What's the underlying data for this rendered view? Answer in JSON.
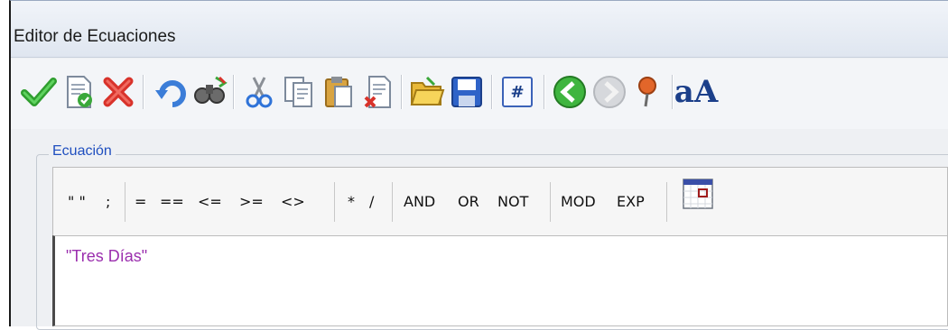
{
  "window": {
    "title": "Editor de Ecuaciones"
  },
  "toolbar": {
    "buttons": [
      {
        "name": "accept",
        "icon": "checkmark-icon"
      },
      {
        "name": "validate",
        "icon": "document-check-icon"
      },
      {
        "name": "cancel",
        "icon": "close-x-icon"
      },
      {
        "name": "undo",
        "icon": "undo-icon"
      },
      {
        "name": "find-replace",
        "icon": "binoculars-icon"
      },
      {
        "name": "cut",
        "icon": "scissors-icon"
      },
      {
        "name": "copy",
        "icon": "copy-icon"
      },
      {
        "name": "paste",
        "icon": "paste-icon"
      },
      {
        "name": "delete",
        "icon": "delete-document-icon"
      },
      {
        "name": "open",
        "icon": "folder-open-icon"
      },
      {
        "name": "save",
        "icon": "floppy-disk-icon"
      },
      {
        "name": "numbering",
        "icon": "hash-icon",
        "label": "#"
      },
      {
        "name": "back",
        "icon": "arrow-left-icon"
      },
      {
        "name": "forward",
        "icon": "arrow-right-icon"
      },
      {
        "name": "pin",
        "icon": "pushpin-icon"
      },
      {
        "name": "font",
        "icon": "font-icon",
        "label": "aA"
      }
    ]
  },
  "group": {
    "label": "Ecuación"
  },
  "equation_toolbar": {
    "quotes": "\" \"",
    "semicolon": ";",
    "eq": "=",
    "eqeq": "==",
    "le": "<=",
    "ge": ">=",
    "ne": "<>",
    "mul": "*",
    "div": "/",
    "and": "AND",
    "or": "OR",
    "not": "NOT",
    "mod": "MOD",
    "exp": "EXP"
  },
  "editor": {
    "content": "\"Tres Días\""
  },
  "colors": {
    "accent_blue": "#1f4fbf",
    "string_purple": "#9b2fae",
    "check_green": "#2f9e2f",
    "cancel_red": "#d8322a"
  }
}
